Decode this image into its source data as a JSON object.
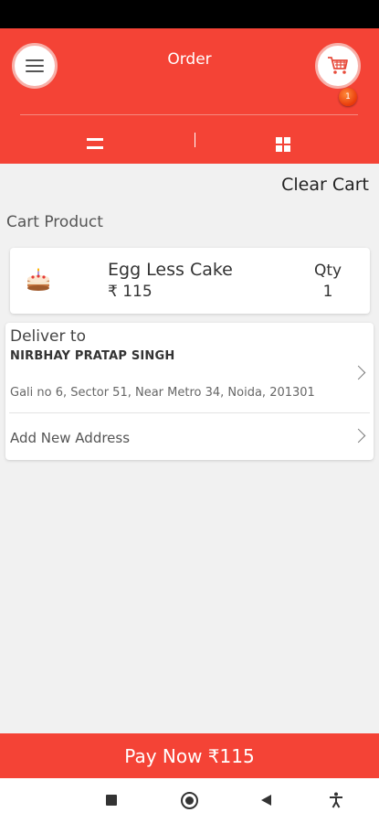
{
  "header": {
    "title": "Order",
    "menu_icon": "hamburger-menu-icon",
    "cart_icon": "shopping-cart-icon",
    "cart_badge_count": "1",
    "view_toggle": {
      "list_icon": "list-view-icon",
      "grid_icon": "grid-view-icon"
    }
  },
  "cart": {
    "clear_label": "Clear Cart",
    "section_title": "Cart Product",
    "items": [
      {
        "name": "Egg Less Cake",
        "price": "₹ 115",
        "qty_label": "Qty",
        "qty": "1",
        "icon": "cake-icon"
      }
    ]
  },
  "delivery": {
    "label": "Deliver to",
    "customer_name": "NIRBHAY PRATAP SINGH",
    "address": "Gali no 6, Sector 51, Near Metro 34, Noida, 201301",
    "add_new_label": "Add New Address"
  },
  "pay_button": {
    "label": "Pay Now ₹115"
  },
  "colors": {
    "accent": "#f44336",
    "background": "#f1f1f1",
    "card": "#ffffff"
  },
  "nav": {
    "recents_icon": "recents-icon",
    "home_icon": "home-icon",
    "back_icon": "back-icon",
    "accessibility_icon": "accessibility-icon"
  }
}
